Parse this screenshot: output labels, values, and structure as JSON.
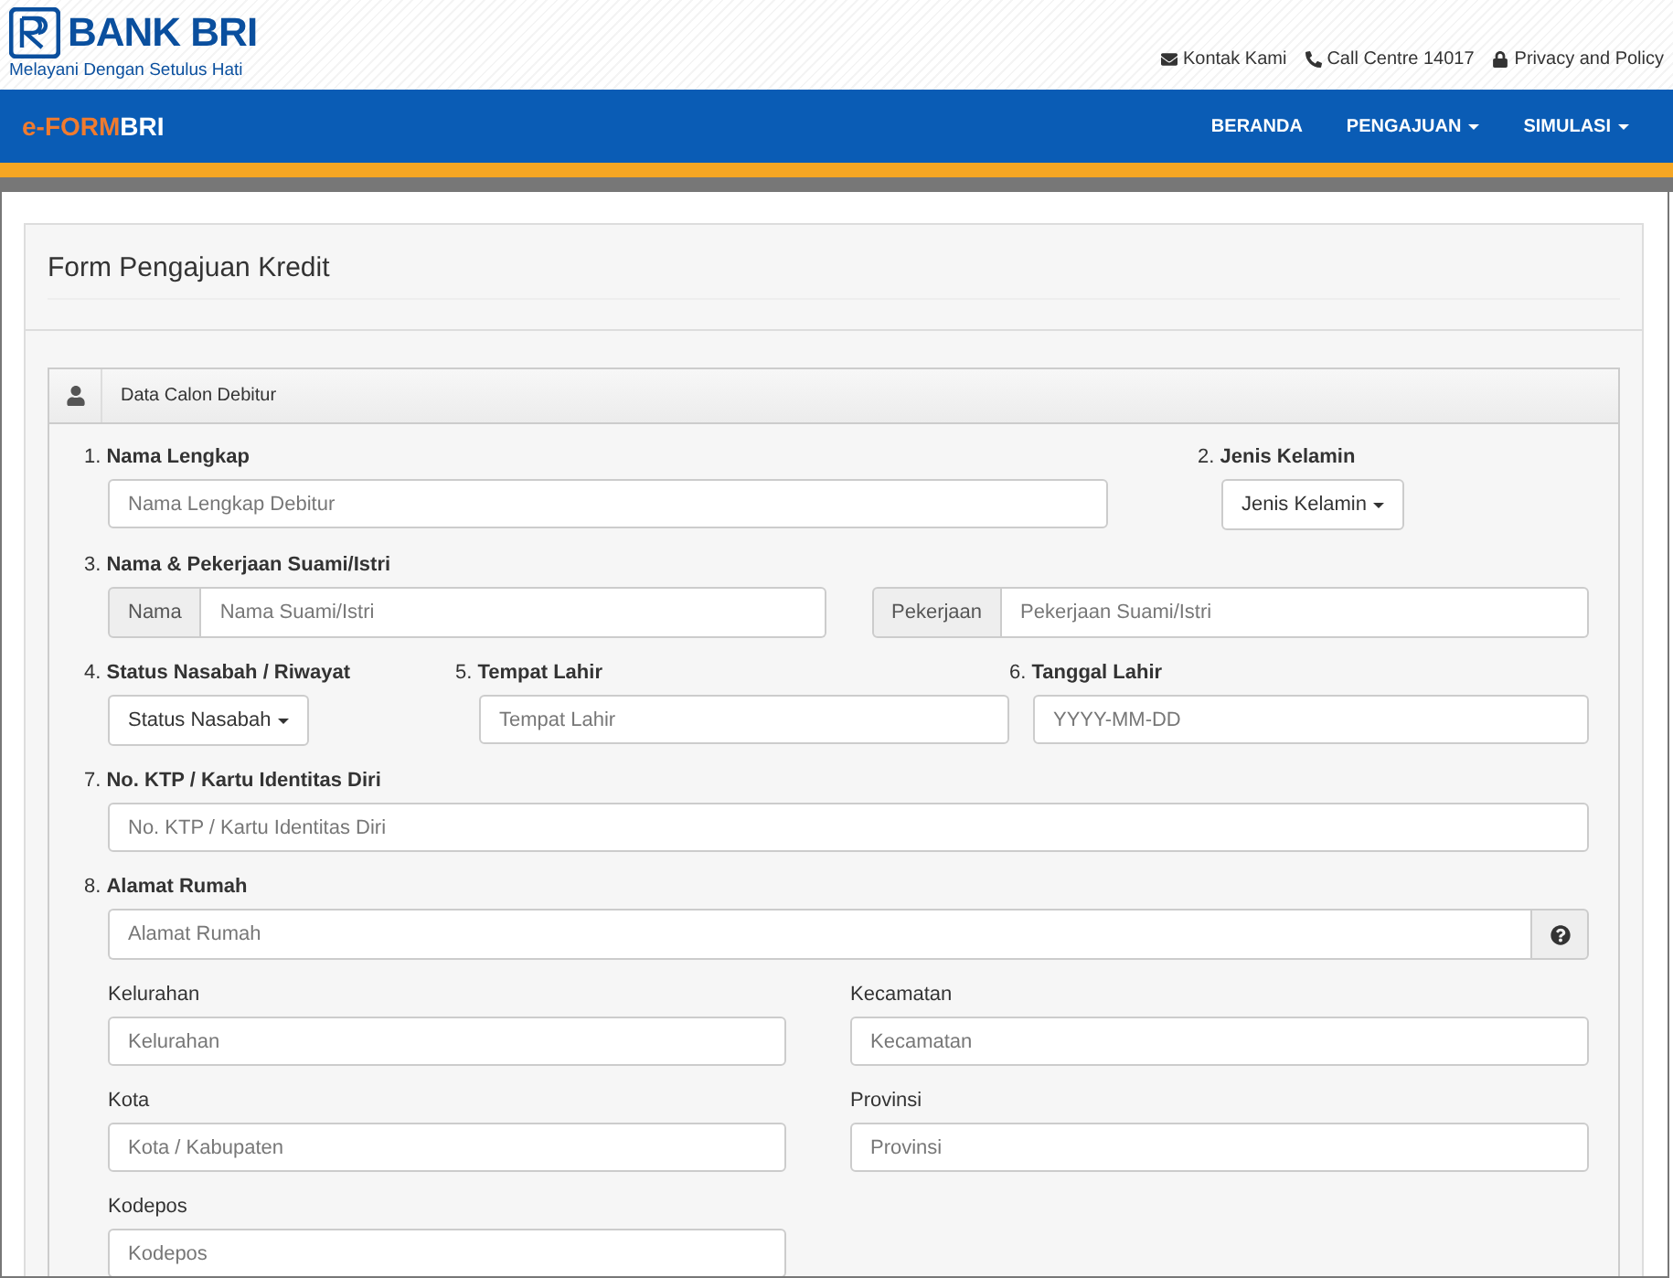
{
  "header": {
    "logo": {
      "name": "BANK BRI",
      "tagline": "Melayani Dengan Setulus Hati"
    },
    "links": [
      {
        "kind": "mail",
        "label": "Kontak Kami"
      },
      {
        "kind": "phone",
        "label": "Call Centre 14017"
      },
      {
        "kind": "lock",
        "label": "Privacy and Policy"
      }
    ]
  },
  "navbar": {
    "brand": {
      "prefix": "e-FORM",
      "suffix": "BRI"
    },
    "items": [
      {
        "label": "BERANDA",
        "dropdown": false
      },
      {
        "label": "PENGAJUAN",
        "dropdown": true
      },
      {
        "label": "SIMULASI",
        "dropdown": true
      }
    ]
  },
  "form": {
    "title": "Form Pengajuan Kredit",
    "section": {
      "title": "Data Calon Debitur",
      "rows": [
        {
          "kind": "main-side",
          "cells": [
            {
              "kind": "input",
              "label": "1. **Nama Lengkap**",
              "placeholder": "Nama Lengkap Debitur"
            },
            {
              "kind": "dropdown",
              "label": "2. **Jenis Kelamin**",
              "value": "Jenis Kelamin"
            }
          ]
        },
        {
          "kind": "pair",
          "label": "3. **Nama & Pekerjaan Suami/Istri**",
          "cells": [
            {
              "kind": "addon-input",
              "addon": "Nama",
              "placeholder": "Nama Suami/Istri"
            },
            {
              "kind": "addon-input",
              "addon": "Pekerjaan",
              "placeholder": "Pekerjaan Suami/Istri"
            }
          ]
        },
        {
          "kind": "triple",
          "cells": [
            {
              "kind": "dropdown",
              "label": "4. **Status Nasabah / Riwayat**",
              "value": "Status Nasabah"
            },
            {
              "kind": "input",
              "label": "5. **Tempat Lahir**",
              "placeholder": "Tempat Lahir"
            },
            {
              "kind": "input",
              "label": "6. **Tanggal Lahir**",
              "placeholder": "YYYY-MM-DD"
            }
          ]
        },
        {
          "kind": "full",
          "cells": [
            {
              "kind": "input",
              "label": "7. **No. KTP / Kartu Identitas Diri**",
              "placeholder": "No. KTP / Kartu Identitas Diri"
            }
          ]
        },
        {
          "kind": "full",
          "cells": [
            {
              "kind": "help-input",
              "label": "8. **Alamat Rumah**",
              "placeholder": "Alamat Rumah"
            }
          ]
        },
        {
          "kind": "sub",
          "cells": [
            {
              "kind": "input",
              "label": "Kelurahan",
              "placeholder": "Kelurahan"
            },
            {
              "kind": "input",
              "label": "Kecamatan",
              "placeholder": "Kecamatan"
            }
          ]
        },
        {
          "kind": "sub",
          "cells": [
            {
              "kind": "input",
              "label": "Kota",
              "placeholder": "Kota / Kabupaten"
            },
            {
              "kind": "input",
              "label": "Provinsi",
              "placeholder": "Provinsi"
            }
          ]
        },
        {
          "kind": "sub",
          "cells": [
            {
              "kind": "input",
              "label": "Kodepos",
              "placeholder": "Kodepos"
            }
          ]
        }
      ]
    }
  }
}
